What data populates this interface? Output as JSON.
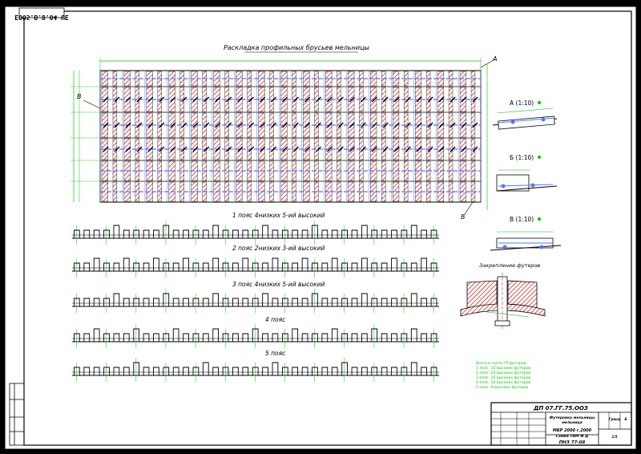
{
  "header": {
    "mirror_code": "EOO5.B.8.O4 UE"
  },
  "main_view": {
    "title": "Раскладка профильных брусьев мельницы",
    "label_a": "А",
    "label_b": "Б",
    "label_v": "В"
  },
  "belts": [
    {
      "title": "1 пояс 4низких 5-ий высокий"
    },
    {
      "title": "2 пояс 2низких 3-ий высокий"
    },
    {
      "title": "3 пояс 4низких 5-ий высокий"
    },
    {
      "title": "4 пояс"
    },
    {
      "title": "5 пояс"
    }
  ],
  "details": [
    {
      "title": "А (1:10)"
    },
    {
      "title": "Б (1:10)"
    },
    {
      "title": "В (1:10)"
    }
  ],
  "fastening": {
    "title": "Закрепление футеров"
  },
  "notes": {
    "lines": [
      "Всего в части 75 футеров",
      "1 пояс -15 высоких футеров",
      "2 пояс -25 высоких футеров",
      "3 пояс -15 высоких футеров",
      "4 пояс -10 высоких футеров",
      "5 пояс -4 высоких футеров"
    ]
  },
  "title_block": {
    "code": "ДП 07.ГГ.75.ООЗ",
    "name_line1": "Футеровка мельницы",
    "name_line2": "мельница",
    "org_line1": "МБР 2000 г.2000",
    "org_line2": "Схема ТИМ Ф Д",
    "group": "ПНЗ 77-08",
    "sheet": "Б",
    "mass": "Гранд",
    "sheet_of": "1/5"
  },
  "colors": {
    "frame": "#000000",
    "dimension": "#00c800",
    "hatch": "#d02828",
    "blue": "#5078ff",
    "paper": "#ffffff"
  }
}
